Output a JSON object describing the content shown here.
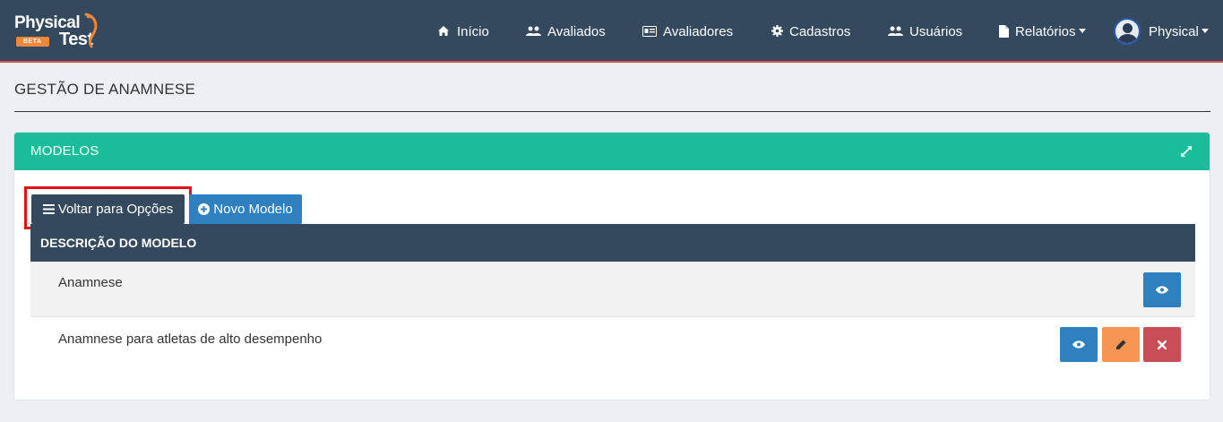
{
  "brand": {
    "line1": "Physical",
    "line2": "Test",
    "badge": "BETA"
  },
  "nav": {
    "inicio": "Início",
    "avaliados": "Avaliados",
    "avaliadores": "Avaliadores",
    "cadastros": "Cadastros",
    "usuarios": "Usuários",
    "relatorios": "Relatórios",
    "user": "Physical"
  },
  "page": {
    "title": "GESTÃO DE ANAMNESE"
  },
  "panel": {
    "title": "MODELOS",
    "back_button": "Voltar para Opções",
    "new_button": "Novo Modelo"
  },
  "table": {
    "header": "DESCRIÇÃO DO MODELO",
    "rows": [
      {
        "description": "Anamnese",
        "actions": [
          "view"
        ]
      },
      {
        "description": "Anamnese para atletas de alto desempenho",
        "actions": [
          "view",
          "edit",
          "delete"
        ]
      }
    ]
  },
  "colors": {
    "navbar": "#34495e",
    "panel_header": "#1abc9c",
    "primary": "#2f80bf",
    "warning": "#f79552",
    "danger": "#c84e55",
    "highlight": "#e3101b"
  }
}
